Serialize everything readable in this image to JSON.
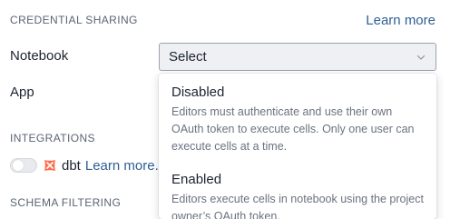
{
  "credential_sharing": {
    "heading": "CREDENTIAL SHARING",
    "learn_more": "Learn more",
    "notebook_label": "Notebook",
    "app_label": "App",
    "select_value": "Select"
  },
  "dropdown": {
    "options": [
      {
        "title": "Disabled",
        "description": "Editors must authenticate and use their own OAuth token to execute cells. Only one user can execute cells at a time."
      },
      {
        "title": "Enabled",
        "description": "Editors execute cells in notebook using the project owner’s OAuth token."
      }
    ]
  },
  "integrations": {
    "heading": "INTEGRATIONS",
    "dbt": {
      "name": "dbt",
      "learn_more": "Learn more.",
      "enabled": false,
      "icon": "dbt-icon",
      "icon_color": "#ff694a"
    }
  },
  "schema_filtering": {
    "heading": "SCHEMA FILTERING"
  },
  "colors": {
    "link": "#2f5e95",
    "heading": "#5b6472"
  }
}
